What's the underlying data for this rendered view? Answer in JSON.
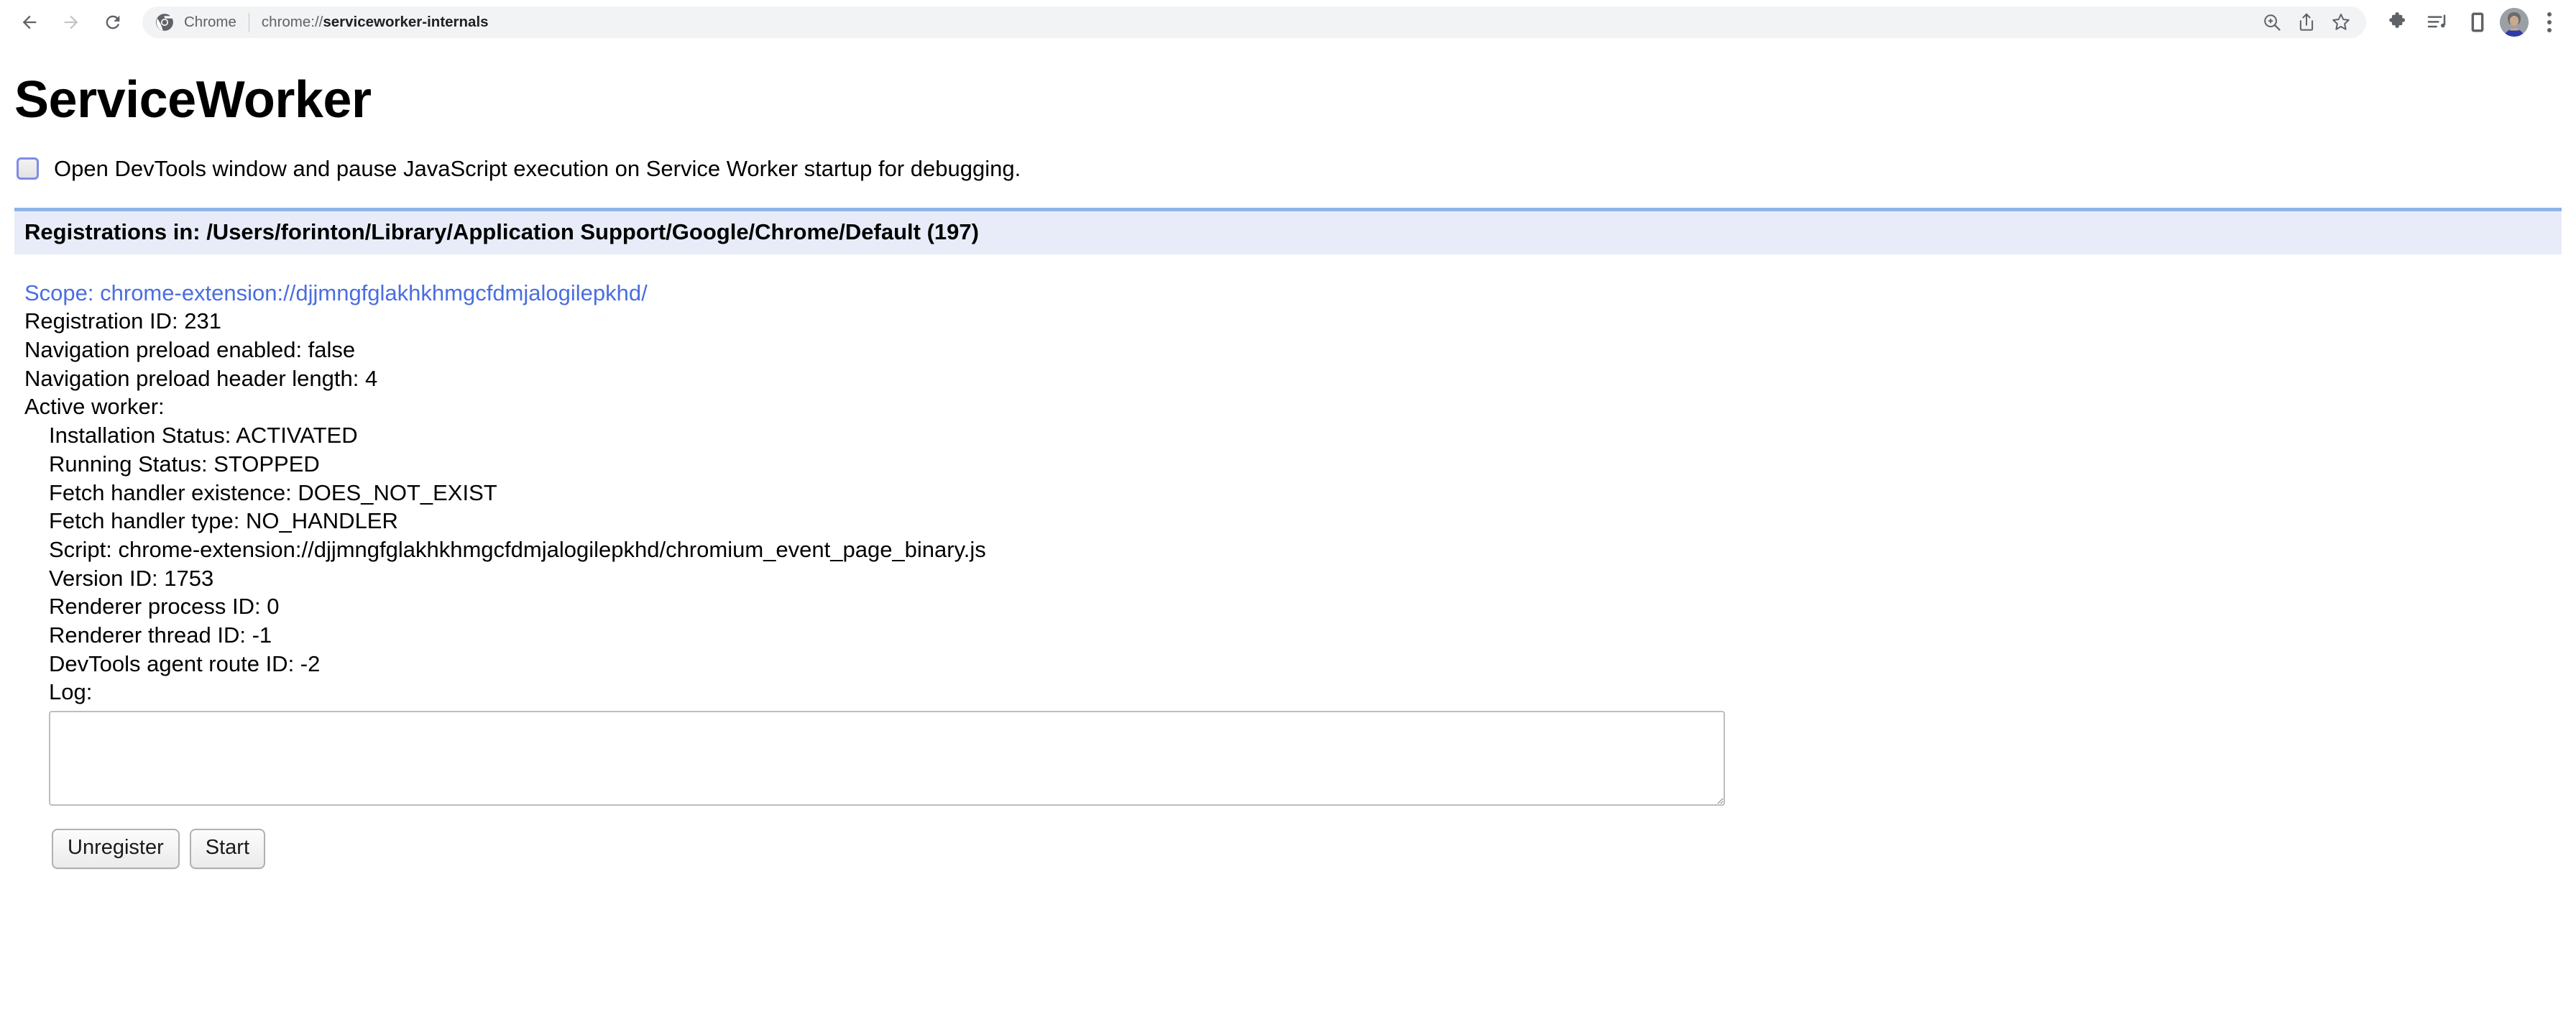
{
  "browser": {
    "back_label": "Back",
    "forward_label": "Forward",
    "reload_label": "Reload",
    "omnibox": {
      "app_name": "Chrome",
      "url_scheme": "chrome://",
      "url_host": "serviceworker-internals",
      "zoom_icon": "zoom-in-icon",
      "share_icon": "share-icon",
      "bookmark_icon": "bookmark-star-icon"
    },
    "actions": {
      "extensions_icon": "extensions-puzzle-icon",
      "media_icon": "media-playlist-icon",
      "device_icon": "device-tablet-icon",
      "profile_icon": "profile-avatar",
      "menu_icon": "three-dot-menu-icon"
    }
  },
  "page": {
    "title": "ServiceWorker",
    "devtools_option": {
      "label": "Open DevTools window and pause JavaScript execution on Service Worker startup for debugging.",
      "checked": false
    },
    "registrations_header": "Registrations in: /Users/forinton/Library/Application Support/Google/Chrome/Default (197)",
    "registration": {
      "scope": "Scope: chrome-extension://djjmngfglakhkhmgcfdmjalogilepkhd/",
      "registration_id": "Registration ID: 231",
      "navigation_preload_enabled": "Navigation preload enabled: false",
      "navigation_preload_header_length": "Navigation preload header length: 4",
      "active_worker_label": "Active worker:",
      "installation_status": "Installation Status: ACTIVATED",
      "running_status": "Running Status: STOPPED",
      "fetch_handler_existence": "Fetch handler existence: DOES_NOT_EXIST",
      "fetch_handler_type": "Fetch handler type: NO_HANDLER",
      "script": "Script: chrome-extension://djjmngfglakhkhmgcfdmjalogilepkhd/chromium_event_page_binary.js",
      "version_id": "Version ID: 1753",
      "renderer_process_id": "Renderer process ID: 0",
      "renderer_thread_id": "Renderer thread ID: -1",
      "devtools_agent_route_id": "DevTools agent route ID: -2",
      "log_label": "Log:",
      "log_value": "",
      "unregister_label": "Unregister",
      "start_label": "Start"
    }
  },
  "colors": {
    "link": "#4a6ee0",
    "header_bg": "#e8ecf8",
    "header_border": "#8fb4e8",
    "checkbox_border": "#7e8ce8",
    "omnibox_bg": "#f1f3f4",
    "text": "#000000",
    "muted_text": "#5f6368"
  }
}
